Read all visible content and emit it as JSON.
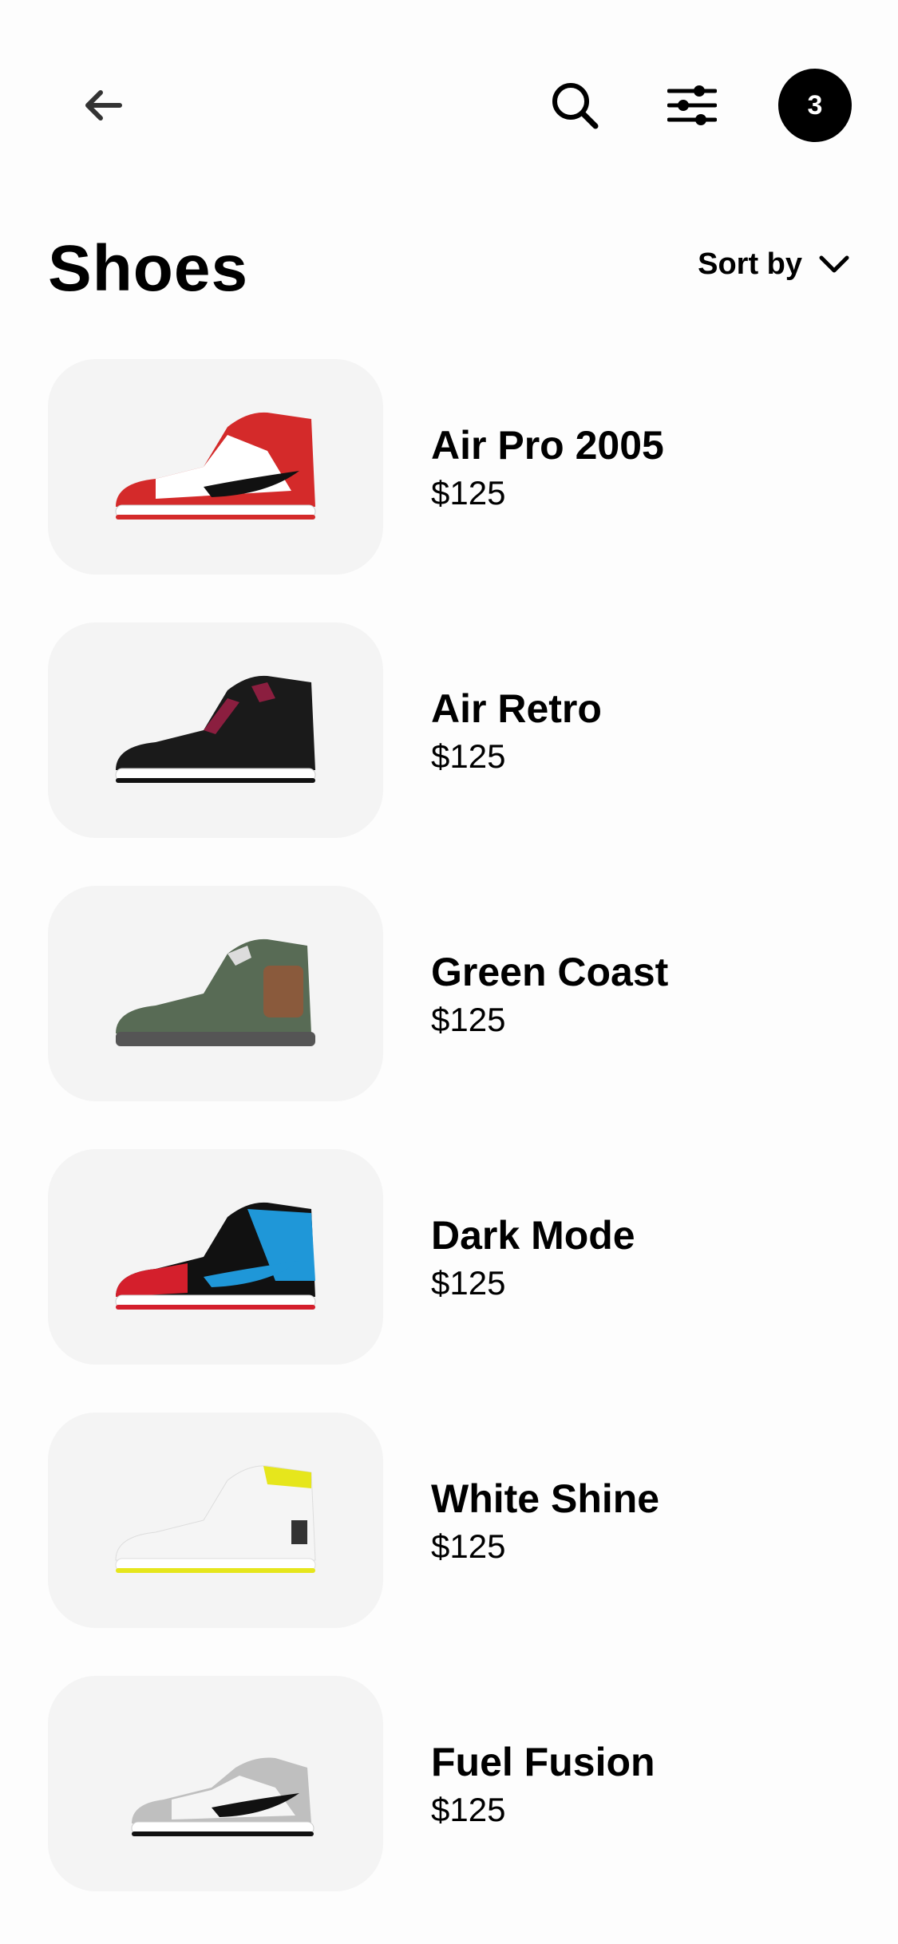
{
  "header": {
    "cart_count": "3",
    "icons": {
      "back": "arrow-left-icon",
      "search": "search-icon",
      "filter": "sliders-icon"
    }
  },
  "page": {
    "title": "Shoes",
    "sort_label": "Sort by"
  },
  "products": [
    {
      "name": "Air Pro 2005",
      "price": "$125",
      "colors": [
        "#d42a2a",
        "#ffffff",
        "#111111"
      ]
    },
    {
      "name": "Air Retro",
      "price": "$125",
      "colors": [
        "#1a1a1a",
        "#8b1e3f",
        "#ffffff"
      ]
    },
    {
      "name": "Green Coast",
      "price": "$125",
      "colors": [
        "#586b55",
        "#8a5a3c",
        "#dcdcdc"
      ]
    },
    {
      "name": "Dark Mode",
      "price": "$125",
      "colors": [
        "#111111",
        "#1f97d8",
        "#d41f2c"
      ]
    },
    {
      "name": "White Shine",
      "price": "$125",
      "colors": [
        "#f5f5f5",
        "#e6e61c",
        "#cccccc"
      ]
    },
    {
      "name": "Fuel Fusion",
      "price": "$125",
      "colors": [
        "#bfbfbf",
        "#111111",
        "#f5f5f5"
      ]
    }
  ]
}
